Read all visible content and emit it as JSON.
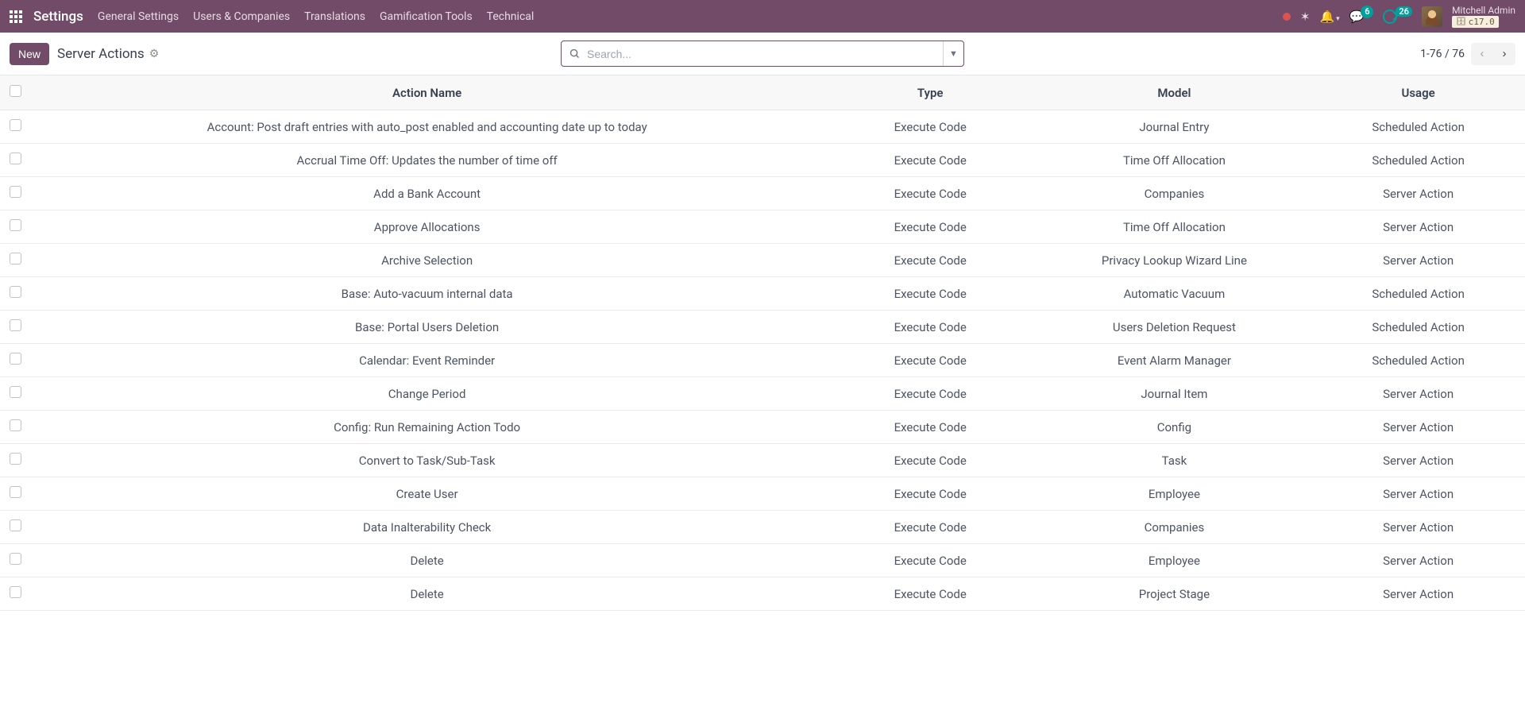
{
  "navbar": {
    "title": "Settings",
    "menu": [
      {
        "label": "General Settings"
      },
      {
        "label": "Users & Companies"
      },
      {
        "label": "Translations"
      },
      {
        "label": "Gamification Tools"
      },
      {
        "label": "Technical"
      }
    ],
    "messages_count": "6",
    "activities_count": "26",
    "user_name": "Mitchell Admin",
    "version": "c17.0"
  },
  "control": {
    "new_label": "New",
    "breadcrumb": "Server Actions",
    "search_placeholder": "Search...",
    "pager_text": "1-76 / 76"
  },
  "table": {
    "headers": {
      "action_name": "Action Name",
      "type": "Type",
      "model": "Model",
      "usage": "Usage"
    },
    "rows": [
      {
        "name": "Account: Post draft entries with auto_post enabled and accounting date up to today",
        "type": "Execute Code",
        "model": "Journal Entry",
        "usage": "Scheduled Action"
      },
      {
        "name": "Accrual Time Off: Updates the number of time off",
        "type": "Execute Code",
        "model": "Time Off Allocation",
        "usage": "Scheduled Action"
      },
      {
        "name": "Add a Bank Account",
        "type": "Execute Code",
        "model": "Companies",
        "usage": "Server Action"
      },
      {
        "name": "Approve Allocations",
        "type": "Execute Code",
        "model": "Time Off Allocation",
        "usage": "Server Action"
      },
      {
        "name": "Archive Selection",
        "type": "Execute Code",
        "model": "Privacy Lookup Wizard Line",
        "usage": "Server Action"
      },
      {
        "name": "Base: Auto-vacuum internal data",
        "type": "Execute Code",
        "model": "Automatic Vacuum",
        "usage": "Scheduled Action"
      },
      {
        "name": "Base: Portal Users Deletion",
        "type": "Execute Code",
        "model": "Users Deletion Request",
        "usage": "Scheduled Action"
      },
      {
        "name": "Calendar: Event Reminder",
        "type": "Execute Code",
        "model": "Event Alarm Manager",
        "usage": "Scheduled Action"
      },
      {
        "name": "Change Period",
        "type": "Execute Code",
        "model": "Journal Item",
        "usage": "Server Action"
      },
      {
        "name": "Config: Run Remaining Action Todo",
        "type": "Execute Code",
        "model": "Config",
        "usage": "Server Action"
      },
      {
        "name": "Convert to Task/Sub-Task",
        "type": "Execute Code",
        "model": "Task",
        "usage": "Server Action"
      },
      {
        "name": "Create User",
        "type": "Execute Code",
        "model": "Employee",
        "usage": "Server Action"
      },
      {
        "name": "Data Inalterability Check",
        "type": "Execute Code",
        "model": "Companies",
        "usage": "Server Action"
      },
      {
        "name": "Delete",
        "type": "Execute Code",
        "model": "Employee",
        "usage": "Server Action"
      },
      {
        "name": "Delete",
        "type": "Execute Code",
        "model": "Project Stage",
        "usage": "Server Action"
      }
    ]
  }
}
